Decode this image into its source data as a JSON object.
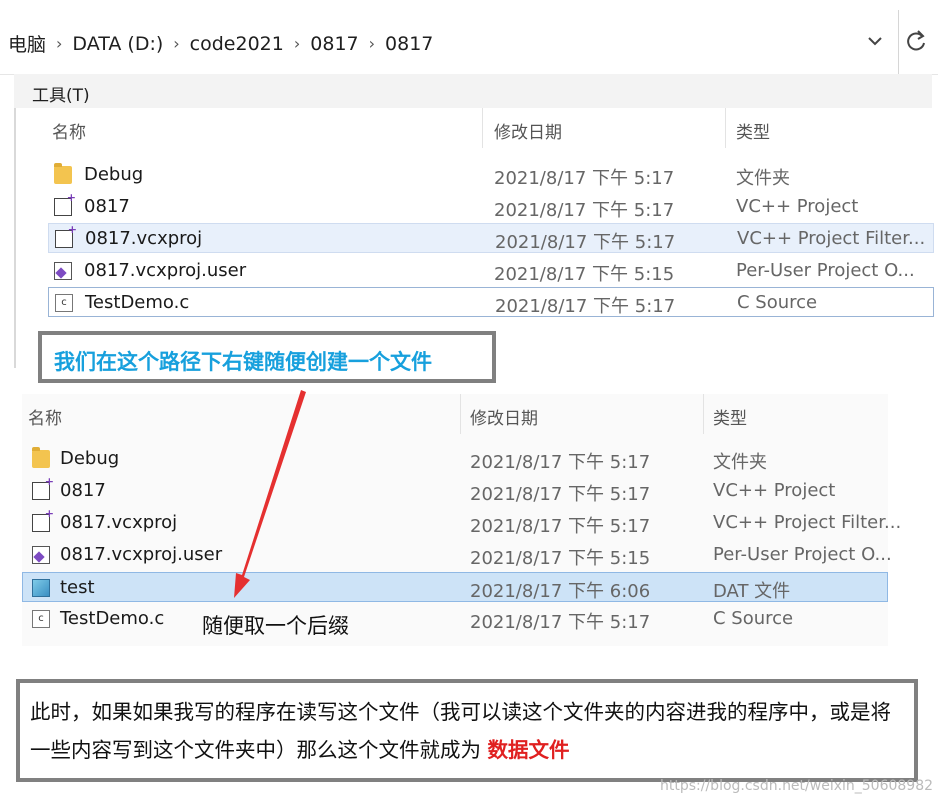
{
  "address_bar": {
    "crumbs": [
      "电脑",
      "DATA (D:)",
      "code2021",
      "0817",
      "0817"
    ],
    "separator": "›",
    "dropdown_icon": "chevron-down-icon",
    "refresh_icon": "refresh-icon"
  },
  "menu": {
    "tools": "工具(T)"
  },
  "list_before": {
    "headers": {
      "name": "名称",
      "date": "修改日期",
      "type": "类型"
    },
    "rows": [
      {
        "name": "Debug",
        "date": "2021/8/17 下午 5:17",
        "type": "文件夹",
        "icon": "folder-icon"
      },
      {
        "name": "0817",
        "date": "2021/8/17 下午 5:17",
        "type": "VC++ Project",
        "icon": "vcxproj-icon"
      },
      {
        "name": "0817.vcxproj",
        "date": "2021/8/17 下午 5:17",
        "type": "VC++ Project Filter...",
        "icon": "vcxproj-filter-icon"
      },
      {
        "name": "0817.vcxproj.user",
        "date": "2021/8/17 下午 5:15",
        "type": "Per-User Project O...",
        "icon": "vs-user-icon"
      },
      {
        "name": "TestDemo.c",
        "date": "2021/8/17 下午 5:17",
        "type": "C Source",
        "icon": "c-source-icon"
      }
    ]
  },
  "callout_top": "我们在这个路径下右键随便创建一个文件",
  "list_after": {
    "headers": {
      "name": "名称",
      "date": "修改日期",
      "type": "类型"
    },
    "rows": [
      {
        "name": "Debug",
        "date": "2021/8/17 下午 5:17",
        "type": "文件夹",
        "icon": "folder-icon"
      },
      {
        "name": "0817",
        "date": "2021/8/17 下午 5:17",
        "type": "VC++ Project",
        "icon": "vcxproj-icon"
      },
      {
        "name": "0817.vcxproj",
        "date": "2021/8/17 下午 5:17",
        "type": "VC++ Project Filter...",
        "icon": "vcxproj-filter-icon"
      },
      {
        "name": "0817.vcxproj.user",
        "date": "2021/8/17 下午 5:15",
        "type": "Per-User Project O...",
        "icon": "vs-user-icon"
      },
      {
        "name": "test",
        "date": "2021/8/17 下午 6:06",
        "type": "DAT 文件",
        "icon": "dat-file-icon"
      },
      {
        "name": "TestDemo.c",
        "date": "2021/8/17 下午 5:17",
        "type": "C Source",
        "icon": "c-source-icon"
      }
    ]
  },
  "note_suffix": "随便取一个后缀",
  "callout_bottom": {
    "text": "此时，如果如果我写的程序在读写这个文件（我可以读这个文件夹的内容进我的程序中，或是将一些内容写到这个文件夹中）那么这个文件就成为 ",
    "highlight": "数据文件"
  },
  "watermark": "https://blog.csdn.net/weixin_50608982",
  "colors": {
    "callout_text": "#17a0dd",
    "highlight": "#e02020",
    "arrow": "#e53030",
    "border": "#808080"
  }
}
